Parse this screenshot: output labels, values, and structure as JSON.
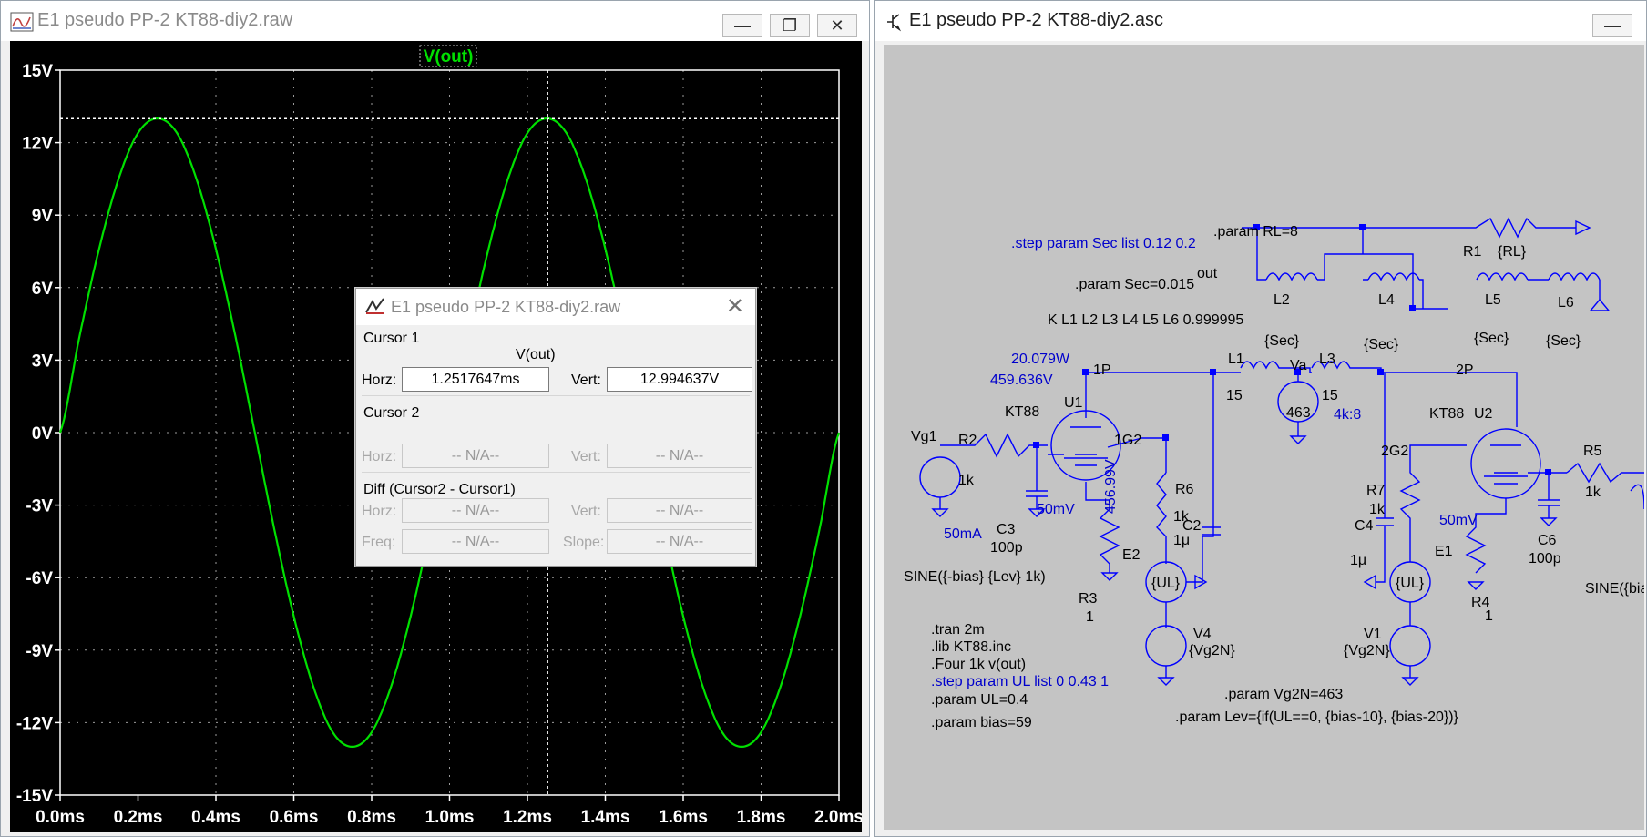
{
  "plot_window": {
    "title": "E1 pseudo PP-2 KT88-diy2.raw",
    "trace_label": "V(out)",
    "trace_color": "#00e000"
  },
  "chart_data": {
    "type": "line",
    "title": "V(out)",
    "x_ticks": [
      "0.0ms",
      "0.2ms",
      "0.4ms",
      "0.6ms",
      "0.8ms",
      "1.0ms",
      "1.2ms",
      "1.4ms",
      "1.6ms",
      "1.8ms",
      "2.0ms"
    ],
    "y_ticks": [
      "15V",
      "12V",
      "9V",
      "6V",
      "3V",
      "0V",
      "-3V",
      "-6V",
      "-9V",
      "-12V",
      "-15V"
    ],
    "xlim_ms": [
      0,
      2
    ],
    "ylim_V": [
      -15,
      15
    ],
    "grid": true,
    "series": [
      {
        "name": "V(out)",
        "color": "#00e000",
        "x": [
          0.0,
          0.05,
          0.1,
          0.15,
          0.2,
          0.25,
          0.3,
          0.35,
          0.4,
          0.45,
          0.5,
          0.55,
          0.6,
          0.65,
          0.7,
          0.75,
          0.8,
          0.85,
          0.9,
          0.95,
          1.0,
          1.05,
          1.1,
          1.15,
          1.2,
          1.25,
          1.3,
          1.35,
          1.4,
          1.45,
          1.5,
          1.55,
          1.6,
          1.65,
          1.7,
          1.75,
          1.8,
          1.85,
          1.9,
          1.95,
          2.0
        ],
        "y": [
          0.0,
          4.0,
          7.6,
          10.5,
          12.4,
          13.0,
          12.4,
          10.5,
          7.6,
          4.0,
          0.0,
          -4.0,
          -7.6,
          -10.5,
          -12.4,
          -13.0,
          -12.4,
          -10.5,
          -7.6,
          -4.0,
          0.0,
          4.0,
          7.6,
          10.5,
          12.4,
          13.0,
          12.4,
          10.5,
          7.6,
          4.0,
          0.0,
          -4.0,
          -7.6,
          -10.5,
          -12.4,
          -13.0,
          -12.4,
          -10.5,
          -7.6,
          -4.0,
          0.0
        ]
      }
    ],
    "cursor": {
      "x_ms": 1.2517647,
      "y_V": 12.994637
    }
  },
  "cursor_dialog": {
    "title": "E1 pseudo PP-2 KT88-diy2.raw",
    "cursor1_label": "Cursor 1",
    "trace": "V(out)",
    "horz_label": "Horz:",
    "vert_label": "Vert:",
    "cursor1_horz": "1.2517647ms",
    "cursor1_vert": "12.994637V",
    "cursor2_label": "Cursor 2",
    "na": "-- N/A--",
    "diff_label": "Diff (Cursor2 - Cursor1)",
    "freq_label": "Freq:",
    "slope_label": "Slope:"
  },
  "schematic_window": {
    "title": "E1 pseudo PP-2 KT88-diy2.asc",
    "directives": {
      "step_sec": ".step param Sec list 0.12 0.2",
      "param_rl": ".param RL=8",
      "param_sec": ".param Sec=0.015",
      "coupling": "K L1 L2  L3 L4 L5 L6 0.999995",
      "tran": ".tran 2m",
      "lib": ".lib KT88.inc",
      "four": ".Four 1k v(out)",
      "step_ul": ".step param UL list 0 0.43 1",
      "param_ul": ".param UL=0.4",
      "param_bias": ".param bias=59",
      "param_vg2n": ".param Vg2N=463",
      "param_lev": ".param Lev={if(UL==0, {bias-10}, {bias-20})}"
    },
    "labels": {
      "out": "out",
      "r1": "R1",
      "r1_val": "{RL}",
      "l2": "L2",
      "l4": "L4",
      "l5": "L5",
      "l6": "L6",
      "sec": "{Sec}",
      "power": "20.079W",
      "voltage": "459.636V",
      "p1": "1P",
      "p2": "2P",
      "l1": "L1",
      "l3": "L3",
      "l_val": "15",
      "va": "Va",
      "va_val": "463",
      "ratio": "4k:8",
      "kt88": "KT88",
      "u1": "U1",
      "u2": "U2",
      "g2_1": "1G2",
      "g2_2": "2G2",
      "vg1": "Vg1",
      "r2": "R2",
      "r_1k": "1k",
      "c3": "C3",
      "c_100p": "100p",
      "ma50": "50mA",
      "mv50": "50mV",
      "v456": "456.99V",
      "r6": "R6",
      "c2": "C2",
      "c_1u": "1μ",
      "r3": "R3",
      "one": "1",
      "e2": "E2",
      "e1": "E1",
      "ul": "{UL}",
      "v4": "V4",
      "v1": "V1",
      "vg2n": "{Vg2N}",
      "sine1": "SINE({-bias} {Lev} 1k)",
      "sine2": "SINE({bia",
      "c4": "C4",
      "r7": "R7",
      "r4": "R4",
      "r5": "R5",
      "c6": "C6"
    },
    "wire_color": "#0000ff",
    "text_color": "#000000",
    "directive_color": "#0000cc"
  }
}
